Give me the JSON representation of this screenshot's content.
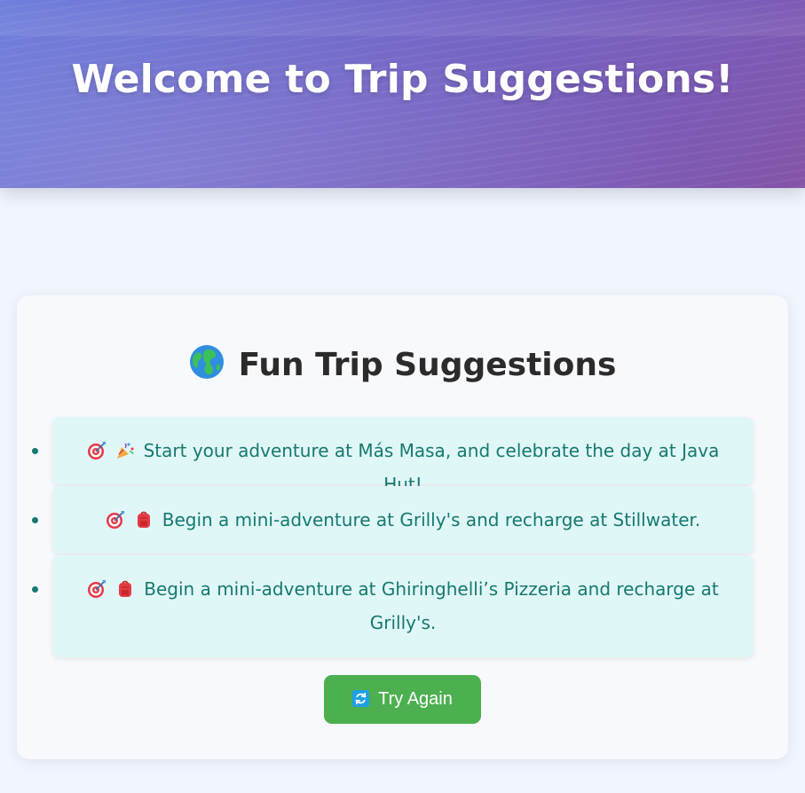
{
  "header": {
    "title": "Welcome to Trip Suggestions!"
  },
  "card": {
    "title": "Fun Trip Suggestions",
    "title_icon": "globe-icon"
  },
  "suggestions": [
    {
      "icons": [
        "target-icon",
        "party-popper-icon"
      ],
      "text": "Start your adventure at Más Masa, and celebrate the day at Java Hut!"
    },
    {
      "icons": [
        "target-icon",
        "backpack-icon"
      ],
      "text": "Begin a mini-adventure at Grilly's and recharge at Stillwater."
    },
    {
      "icons": [
        "target-icon",
        "backpack-icon"
      ],
      "text": "Begin a mini-adventure at Ghiringhelli’s Pizzeria and recharge at Grilly's."
    }
  ],
  "button": {
    "label": "Try Again",
    "icon": "refresh-icon"
  },
  "colors": {
    "accent_green": "#4caf50",
    "item_bg": "#e0f7f8",
    "item_text": "#16796f"
  }
}
